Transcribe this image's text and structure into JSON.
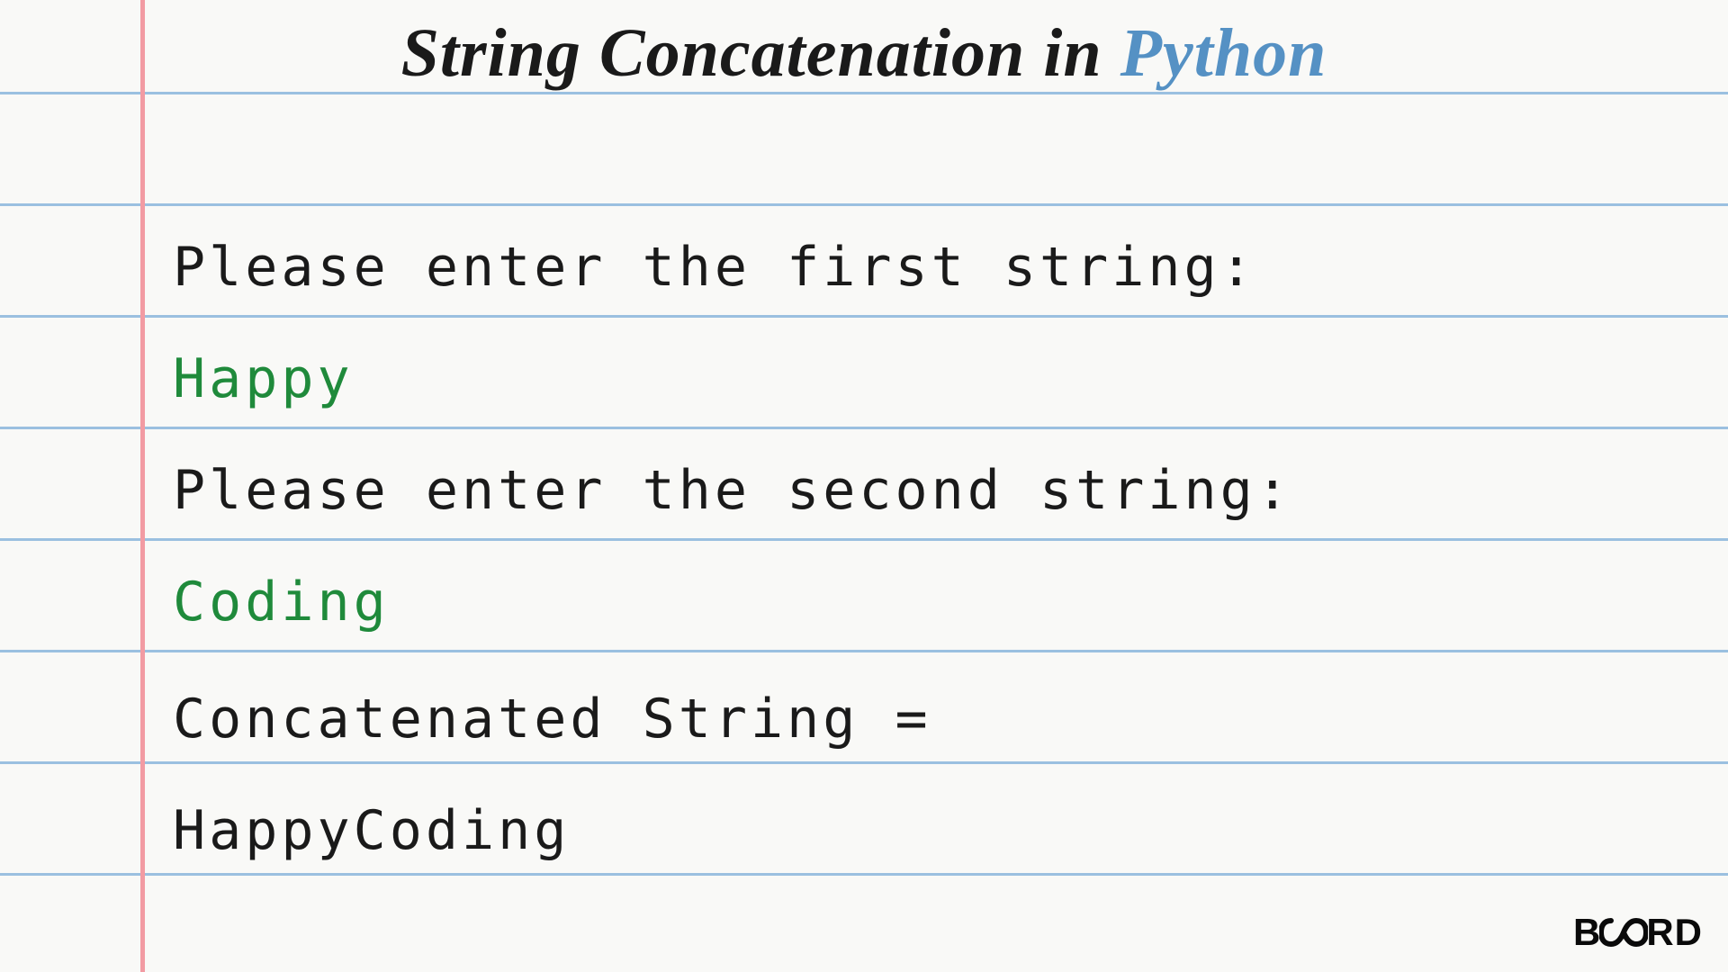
{
  "title": {
    "main": "String Concatenation in ",
    "accent": "Python"
  },
  "lines": {
    "prompt1": "Please enter the first string:",
    "input1": "Happy",
    "prompt2": "Please enter the second string:",
    "input2": "Coding",
    "resultLabel": "Concatenated String = ",
    "resultValue": "HappyCoding"
  },
  "logo": {
    "left": "B",
    "right": "RD"
  },
  "ruleLines": [
    102,
    226,
    350,
    474,
    598,
    722,
    846,
    970
  ],
  "colors": {
    "rule": "#9bc0e0",
    "margin": "#f29ba3",
    "accent": "#5591c4",
    "input": "#1f8a3b"
  }
}
